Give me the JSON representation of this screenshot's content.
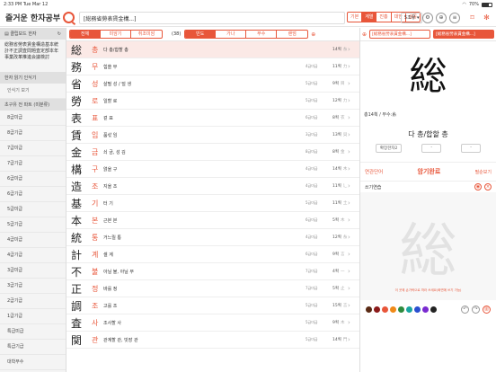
{
  "status": {
    "time": "2:33 PM",
    "date": "Tue Mar 12",
    "battery": "70%"
  },
  "app": {
    "title": "즐거운 한자공부"
  },
  "search": {
    "value": "[総務省勞表賃金構...]"
  },
  "mode_segments": [
    {
      "label": "기본",
      "active": false
    },
    {
      "label": "계열",
      "active": true
    },
    {
      "label": "진흥",
      "active": false
    },
    {
      "label": "대한",
      "active": false
    },
    {
      "label": "상공",
      "active": false
    }
  ],
  "size_button": "5조류 ▾",
  "sidebar": {
    "clipboard_label": "클립보드 한자",
    "clipboard_text": "総務省勞表賃金構造基本統計不正調査問題査定部本年事業改革推進会議検討",
    "read_label": "한자 읽기 인식기",
    "read_item": "인식기 보기",
    "group_label": "초구유 전 파트 (미분류)",
    "levels": [
      "8급미급",
      "8급기급",
      "7급미급",
      "7급기급",
      "6급미급",
      "6급기급",
      "5급미급",
      "5급기급",
      "4급미급",
      "4급기급",
      "3급미급",
      "3급기급",
      "2급기급",
      "1급기급",
      "특급미급",
      "특급기급",
      "대학부수"
    ]
  },
  "list": {
    "tabs": [
      {
        "label": "전체",
        "active": true
      },
      {
        "label": "미암기",
        "active": false
      },
      {
        "label": "취조미암",
        "active": false
      }
    ],
    "count": "(38)",
    "sort_tabs": [
      {
        "label": "빈도",
        "active": true
      },
      {
        "label": "가나",
        "active": false
      },
      {
        "label": "부수",
        "active": false
      },
      {
        "label": "랜덤",
        "active": false
      }
    ],
    "rows": [
      {
        "hanja": "総",
        "eum": "총",
        "hun": "다 총/합할 총",
        "level": "",
        "strokes": "14획",
        "radical": "糸",
        "selected": true
      },
      {
        "hanja": "務",
        "eum": "무",
        "hun": "힘쓸 무",
        "level": "4급미급",
        "strokes": "11획",
        "radical": "力",
        "selected": false
      },
      {
        "hanja": "省",
        "eum": "성",
        "hun": "살필 성 / 덜 생",
        "level": "5급미급",
        "strokes": "9획",
        "radical": "目",
        "selected": false
      },
      {
        "hanja": "勞",
        "eum": "로",
        "hun": "일할 로",
        "level": "5급미급",
        "strokes": "12획",
        "radical": "力",
        "selected": false
      },
      {
        "hanja": "表",
        "eum": "표",
        "hun": "겉 표",
        "level": "6급미급",
        "strokes": "8획",
        "radical": "衣",
        "selected": false
      },
      {
        "hanja": "賃",
        "eum": "임",
        "hun": "품삯 임",
        "level": "3급미급",
        "strokes": "13획",
        "radical": "貝",
        "selected": false
      },
      {
        "hanja": "金",
        "eum": "금",
        "hun": "쇠 금, 성 김",
        "level": "8급미급",
        "strokes": "8획",
        "radical": "金",
        "selected": false
      },
      {
        "hanja": "構",
        "eum": "구",
        "hun": "얽을 구",
        "level": "4급미급",
        "strokes": "14획",
        "radical": "木",
        "selected": false
      },
      {
        "hanja": "造",
        "eum": "조",
        "hun": "지을 조",
        "level": "4급미급",
        "strokes": "11획",
        "radical": "辶",
        "selected": false
      },
      {
        "hanja": "基",
        "eum": "기",
        "hun": "터 기",
        "level": "5급미급",
        "strokes": "11획",
        "radical": "土",
        "selected": false
      },
      {
        "hanja": "本",
        "eum": "본",
        "hun": "근본 본",
        "level": "6급미급",
        "strokes": "5획",
        "radical": "木",
        "selected": false
      },
      {
        "hanja": "統",
        "eum": "통",
        "hun": "거느릴 통",
        "level": "4급미급",
        "strokes": "12획",
        "radical": "糸",
        "selected": false
      },
      {
        "hanja": "計",
        "eum": "계",
        "hun": "셀 계",
        "level": "6급미급",
        "strokes": "9획",
        "radical": "言",
        "selected": false
      },
      {
        "hanja": "不",
        "eum": "불",
        "hun": "아닐 불, 아닐 부",
        "level": "7급미급",
        "strokes": "4획",
        "radical": "一",
        "selected": false
      },
      {
        "hanja": "正",
        "eum": "정",
        "hun": "바를 정",
        "level": "7급미급",
        "strokes": "5획",
        "radical": "止",
        "selected": false
      },
      {
        "hanja": "調",
        "eum": "조",
        "hun": "고를 조",
        "level": "5급미급",
        "strokes": "15획",
        "radical": "言",
        "selected": false
      },
      {
        "hanja": "査",
        "eum": "사",
        "hun": "조사할 사",
        "level": "5급미급",
        "strokes": "9획",
        "radical": "木",
        "selected": false
      },
      {
        "hanja": "関",
        "eum": "관",
        "hun": "관계할 관, 빗장 관",
        "level": "5급미급",
        "strokes": "14획",
        "radical": "門",
        "selected": false
      }
    ]
  },
  "detail": {
    "tab1": "[総務省勞表賃金構...]",
    "tab2": "[総務省勞表賃金構...]",
    "char": "総",
    "meta": "총14획 / 부수:糸",
    "meaning": "다 총/합할 총",
    "btn_expand": "확장한자2",
    "btn_b": "-",
    "btn_c": "-",
    "related": "연관단어",
    "memorized": "암기완료",
    "practice_link": "필순보기",
    "practice_label": "쓰기연습",
    "practice_note": "이 곳에 손가락으로 따라 쓰세요(화면에 쓰기 가능)",
    "palette": [
      "#5a2a14",
      "#8b1a1a",
      "#e8563a",
      "#f08a18",
      "#2e8b3e",
      "#1aa6a0",
      "#2a4fd0",
      "#7a2ad0",
      "#222222"
    ]
  }
}
